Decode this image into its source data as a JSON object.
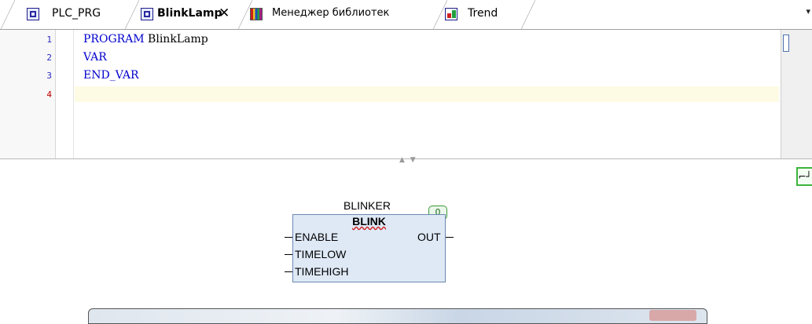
{
  "tabs": [
    {
      "label": "PLC_PRG",
      "icon": "program-icon",
      "active": false
    },
    {
      "label": "BlinkLamp",
      "icon": "program-icon",
      "active": true,
      "close": "✕"
    },
    {
      "label": "Менеджер библиотек",
      "icon": "library-icon",
      "active": false
    },
    {
      "label": "Trend",
      "icon": "trend-icon",
      "active": false
    }
  ],
  "tab_overflow_glyph": "▾",
  "editor": {
    "line_numbers": [
      "1",
      "2",
      "3",
      "4"
    ],
    "lines": [
      {
        "keyword": "PROGRAM",
        "rest": " BlinkLamp"
      },
      {
        "keyword": "VAR",
        "rest": ""
      },
      {
        "keyword": "END_VAR",
        "rest": ""
      },
      {
        "keyword": "",
        "rest": ""
      }
    ],
    "current_line": 4
  },
  "splitter_glyph": "▲ ▼",
  "fbd": {
    "toolbox_glyph": "⌐┘",
    "instance_name": "BLINKER",
    "type_name": "BLINK",
    "execution_order": "0",
    "inputs": [
      "ENABLE",
      "TIMELOW",
      "TIMEHIGH"
    ],
    "outputs": [
      "OUT"
    ]
  },
  "colors": {
    "keyword": "#0000cc",
    "current_line_number": "#c00000",
    "line_number": "#2b2bc0",
    "fb_fill": "#dfe9f6",
    "current_line_highlight": "#fdfbe4"
  }
}
